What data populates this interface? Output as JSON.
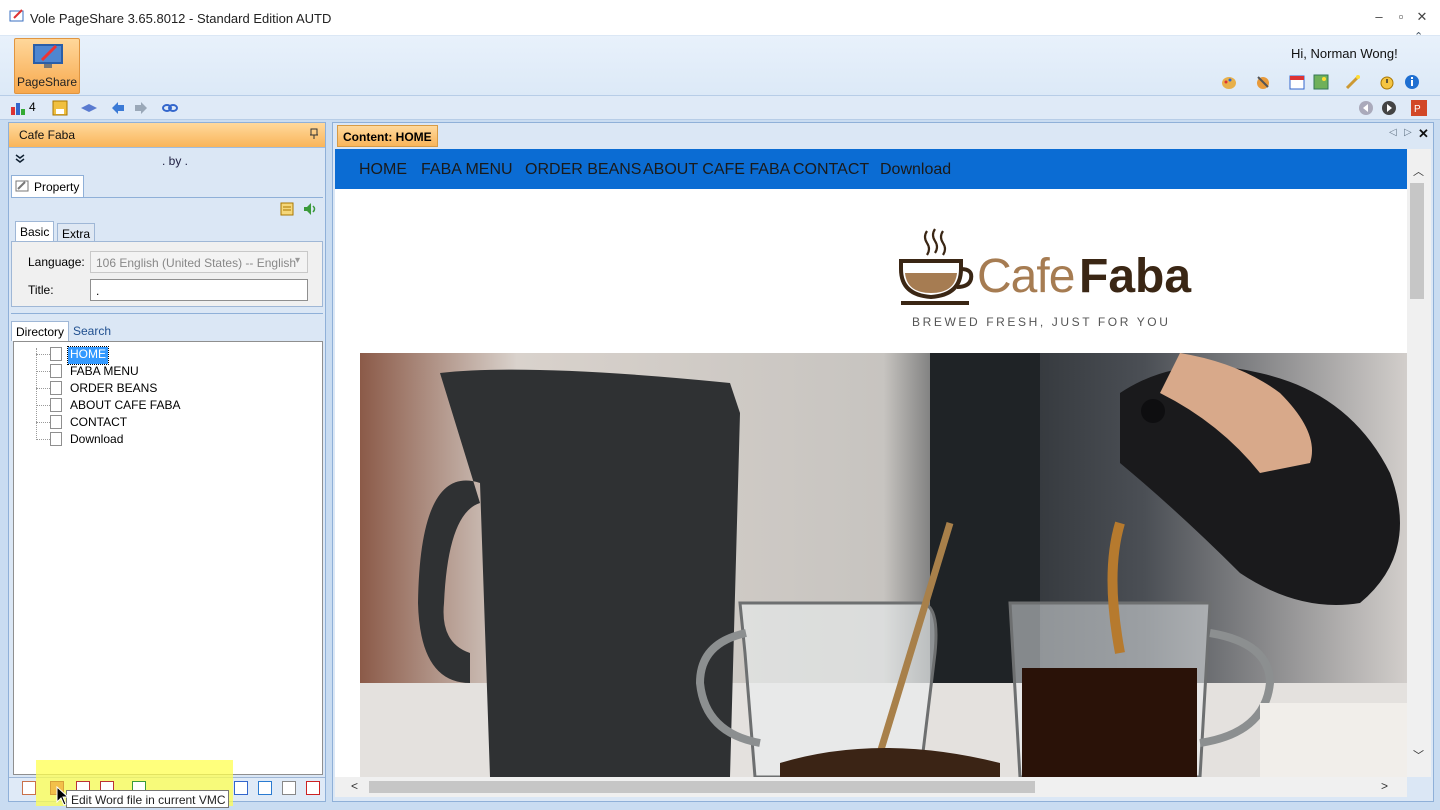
{
  "window": {
    "title": "Vole PageShare  3.65.8012 - Standard Edition AUTD",
    "minimize": "–",
    "maximize": "▫",
    "close": "✕"
  },
  "ribbon": {
    "pageshare_label": "PageShare",
    "greeting": "Hi, Norman Wong!",
    "collapse_glyph": "⌃"
  },
  "toolbar": {
    "count": "4"
  },
  "left_panel": {
    "header": "Cafe Faba",
    "pin": "📌",
    "by_text": ". by .",
    "property_tab": "Property",
    "basic_tab": "Basic",
    "extra_tab": "Extra",
    "language_label": "Language:",
    "language_value": "106 English (United States) -- English",
    "title_label": "Title:",
    "title_value": ".",
    "directory_tab": "Directory",
    "search_tab": "Search",
    "tree": [
      "HOME",
      "FABA MENU",
      "ORDER BEANS",
      "ABOUT CAFE FABA",
      "CONTACT",
      "Download"
    ]
  },
  "content": {
    "tab_label": "Content: HOME",
    "nav": [
      "HOME",
      "FABA MENU",
      "ORDER BEANS",
      "ABOUT CAFE FABA",
      "CONTACT",
      "Download"
    ],
    "logo_part1": "Cafe",
    "logo_part2": "Faba",
    "tagline": "BREWED FRESH, JUST FOR YOU"
  },
  "tooltip": "Edit Word file in current VMC",
  "bottom_icons": [
    "home-icon",
    "word-edit-icon",
    "vmc-icon",
    "doc-icon",
    "eye-icon",
    "checklist-icon",
    "globe-icon",
    "page-icon",
    "text-icon"
  ],
  "colors": {
    "nav_blue": "#0b6cd3",
    "accent_orange": "#f9b55a",
    "logo_brown": "#3a2614",
    "logo_tan": "#a67c52"
  }
}
